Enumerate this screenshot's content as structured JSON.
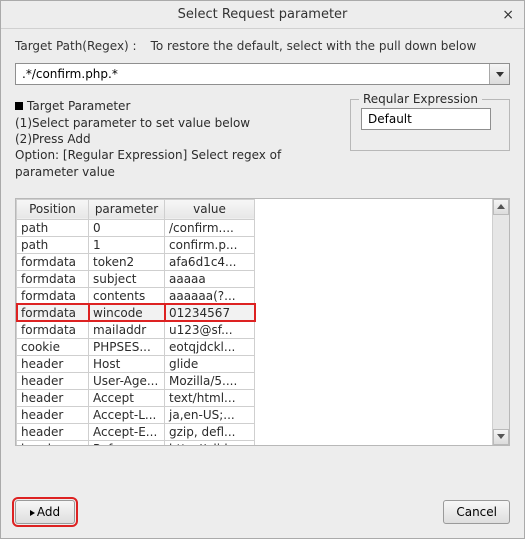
{
  "title": "Select Request parameter",
  "target_path_label": "Target Path(Regex) :",
  "target_path_hint": "To restore the default, select with the pull down below",
  "target_path_value": ".*/confirm.php.*",
  "target_parameter_label": "Target Parameter",
  "instructions": {
    "line1": "(1)Select parameter to set value below",
    "line2": "(2)Press Add",
    "line3": "Option: [Regular Expression] Select regex of parameter value"
  },
  "regex_fieldset_label": "Reqular Expression",
  "regex_value": "Default",
  "columns": {
    "c1": "Position",
    "c2": "parameter",
    "c3": "value"
  },
  "rows": [
    {
      "pos": "path",
      "param": "0",
      "val": "/confirm...."
    },
    {
      "pos": "path",
      "param": "1",
      "val": "confirm.p..."
    },
    {
      "pos": "formdata",
      "param": "token2",
      "val": "afa6d1c4..."
    },
    {
      "pos": "formdata",
      "param": "subject",
      "val": "aaaaa"
    },
    {
      "pos": "formdata",
      "param": "contents",
      "val": "aaaaaa(?..."
    },
    {
      "pos": "formdata",
      "param": "wincode",
      "val": "01234567",
      "selected": true
    },
    {
      "pos": "formdata",
      "param": "mailaddr",
      "val": "u123@sf..."
    },
    {
      "pos": "cookie",
      "param": "PHPSES...",
      "val": "eotqjdckl..."
    },
    {
      "pos": "header",
      "param": "Host",
      "val": "glide"
    },
    {
      "pos": "header",
      "param": "User-Age...",
      "val": "Mozilla/5...."
    },
    {
      "pos": "header",
      "param": "Accept",
      "val": "text/html..."
    },
    {
      "pos": "header",
      "param": "Accept-L...",
      "val": "ja,en-US;..."
    },
    {
      "pos": "header",
      "param": "Accept-E...",
      "val": "gzip, defl..."
    },
    {
      "pos": "header",
      "param": "Referer",
      "val": "http://glid"
    }
  ],
  "buttons": {
    "add": "Add",
    "cancel": "Cancel"
  }
}
